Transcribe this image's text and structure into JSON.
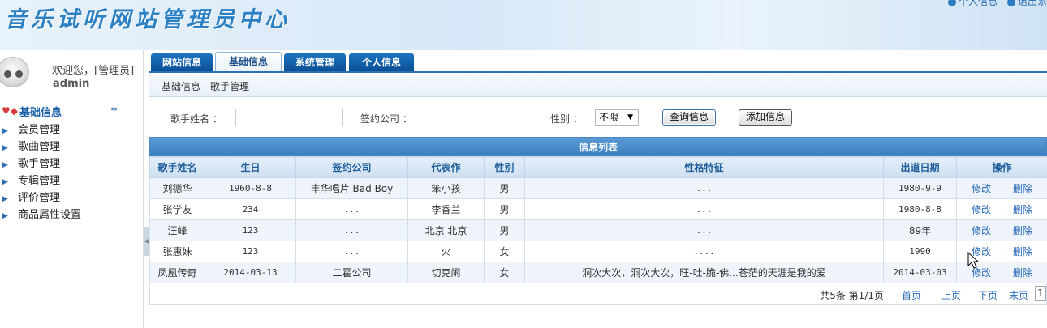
{
  "header": {
    "title": "音乐试听网站管理员中心",
    "links": [
      "个人信息",
      "退出系"
    ]
  },
  "user": {
    "welcome": "欢迎您，[管理员]",
    "name": "admin"
  },
  "sidebar": {
    "section_title": "基础信息",
    "items": [
      "会员管理",
      "歌曲管理",
      "歌手管理",
      "专辑管理",
      "评价管理",
      "商品属性设置"
    ]
  },
  "tabs": [
    "网站信息",
    "基础信息",
    "系统管理",
    "个人信息"
  ],
  "active_tab": "基础信息",
  "breadcrumb": "基础信息  -  歌手管理",
  "search": {
    "singer_label": "歌手姓名 ：",
    "company_label": "签约公司 ：",
    "gender_label": "性别 ：",
    "gender_value": "不限",
    "query_button": "查询信息",
    "add_button": "添加信息"
  },
  "grid": {
    "title": "信息列表",
    "columns": [
      "歌手姓名",
      "生日",
      "签约公司",
      "代表作",
      "性别",
      "性格特征",
      "出道日期",
      "操作"
    ],
    "rows": [
      [
        "刘德华",
        "1960-8-8",
        "丰华唱片 Bad Boy",
        "笨小孩",
        "男",
        "...",
        "1980-9-9"
      ],
      [
        "张学友",
        "234",
        "...",
        "李香兰",
        "男",
        "...",
        "1980-8-8"
      ],
      [
        "汪峰",
        "123",
        "...",
        "北京 北京",
        "男",
        "...",
        "89年"
      ],
      [
        "张惠妹",
        "123",
        "...",
        "火",
        "女",
        "....",
        "1990"
      ],
      [
        "凤凰传奇",
        "2014-03-13",
        "二霍公司",
        "切克闹",
        "女",
        "洞次大次，洞次大次，旺-吐-脆-佛...苍茫的天涯是我的爱",
        "2014-03-03"
      ]
    ],
    "edit_label": "修改",
    "sep": "|",
    "delete_label": "删除"
  },
  "pager": {
    "info": "共5条  第1/1页",
    "first": "首页",
    "prev": "上页",
    "next": "下页",
    "last": "末页",
    "page_input": "1"
  }
}
